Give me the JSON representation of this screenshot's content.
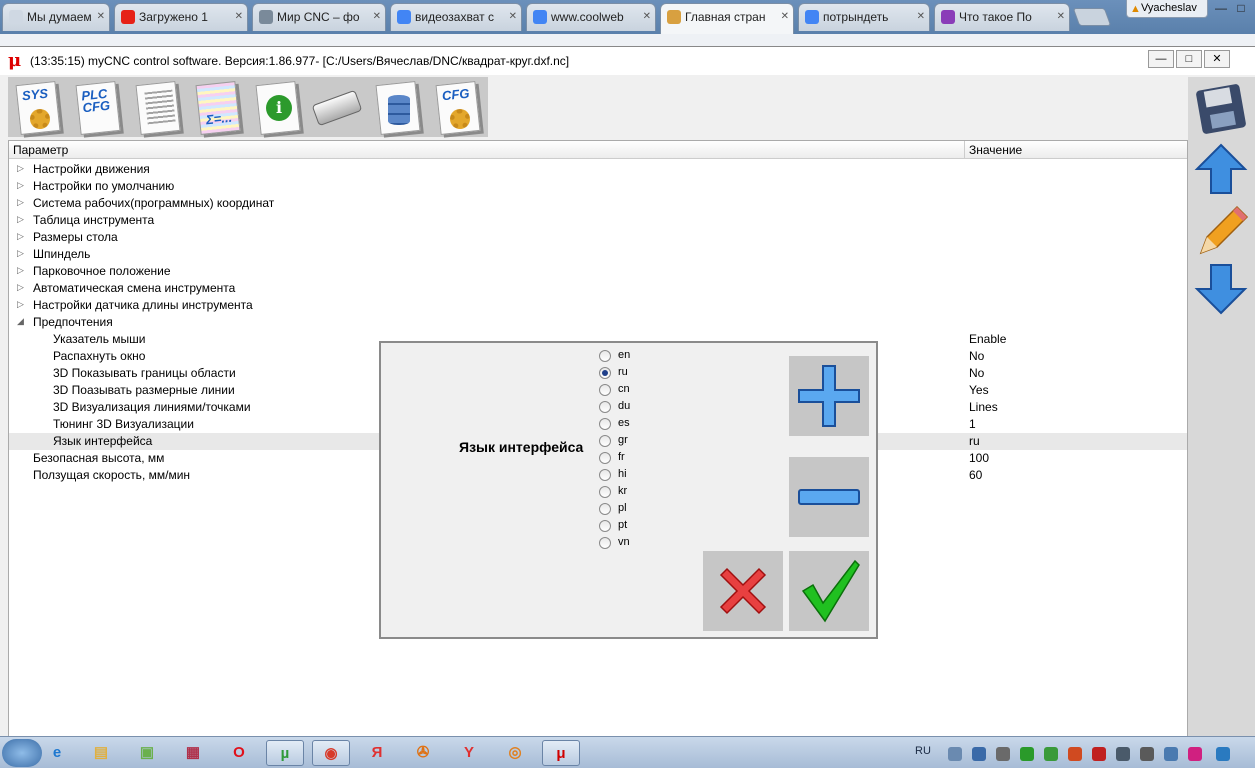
{
  "browser": {
    "tabs": [
      {
        "label": "Мы думаем, ч",
        "icon_color": "#cfd8e3"
      },
      {
        "label": "Загружено 1",
        "icon_color": "#e62117"
      },
      {
        "label": "Мир CNC – фо",
        "icon_color": "#7a8a9a"
      },
      {
        "label": "видеозахват с",
        "icon_color": "#4285f4"
      },
      {
        "label": "www.coolweb",
        "icon_color": "#4285f4"
      },
      {
        "label": "Главная стран",
        "icon_color": "#d8a040"
      },
      {
        "label": "потрындеть",
        "icon_color": "#4285f4"
      },
      {
        "label": "Что такое По",
        "icon_color": "#8a3cb8"
      }
    ],
    "user": "Vyacheslav",
    "minimize": "—",
    "maximize": "□",
    "close": "✕"
  },
  "window": {
    "logo": "μ",
    "title": "(13:35:15)   myCNC control software. Версия:1.86.977-   [C:/Users/Вячеслав/DNC/квадрат-круг.dxf.nc]",
    "minimize": "—",
    "maximize": "□",
    "close": "✕"
  },
  "toolbar": [
    {
      "name": "sys",
      "label": "SYS"
    },
    {
      "name": "plc-cfg",
      "label": "PLC\nCFG"
    },
    {
      "name": "table",
      "label": ""
    },
    {
      "name": "formula",
      "label": "Σ=..."
    },
    {
      "name": "info",
      "label": "i"
    },
    {
      "name": "camera",
      "label": ""
    },
    {
      "name": "database",
      "label": ""
    },
    {
      "name": "cfg",
      "label": "CFG"
    }
  ],
  "tree": {
    "col_param": "Параметр",
    "col_value": "Значение",
    "rows": [
      {
        "name": "Настройки движения",
        "value": "",
        "level": 0,
        "expanded": false
      },
      {
        "name": "Настройки по умолчанию",
        "value": "",
        "level": 0,
        "expanded": false
      },
      {
        "name": "Система рабочих(программных) координат",
        "value": "",
        "level": 0,
        "expanded": false
      },
      {
        "name": "Таблица инструмента",
        "value": "",
        "level": 0,
        "expanded": false
      },
      {
        "name": "Размеры стола",
        "value": "",
        "level": 0,
        "expanded": false
      },
      {
        "name": "Шпиндель",
        "value": "",
        "level": 0,
        "expanded": false
      },
      {
        "name": "Парковочное положение",
        "value": "",
        "level": 0,
        "expanded": false
      },
      {
        "name": "Автоматическая смена инструмента",
        "value": "",
        "level": 0,
        "expanded": false
      },
      {
        "name": "Настройки датчика длины инструмента",
        "value": "",
        "level": 0,
        "expanded": false
      },
      {
        "name": "Предпочтения",
        "value": "",
        "level": 0,
        "expanded": true
      },
      {
        "name": "Указатель мыши",
        "value": "Enable",
        "level": 1
      },
      {
        "name": "Распахнуть окно",
        "value": "No",
        "level": 1
      },
      {
        "name": "3D Показывать границы области",
        "value": "No",
        "level": 1
      },
      {
        "name": "3D Поазывать размерные линии",
        "value": "Yes",
        "level": 1
      },
      {
        "name": "3D Визуализация линиями/точками",
        "value": "Lines",
        "level": 1
      },
      {
        "name": "Тюнинг 3D Визуализации",
        "value": "1",
        "level": 1
      },
      {
        "name": "Язык интерфейса",
        "value": "ru",
        "level": 1,
        "selected": true
      },
      {
        "name": "Безопасная высота, мм",
        "value": "100",
        "level": 0,
        "leaf": true
      },
      {
        "name": "Ползущая скорость, мм/мин",
        "value": "60",
        "level": 0,
        "leaf": true
      }
    ]
  },
  "dialog": {
    "label": "Язык интерфейса",
    "selected": "ru",
    "options": [
      "en",
      "ru",
      "cn",
      "du",
      "es",
      "gr",
      "fr",
      "hi",
      "kr",
      "pl",
      "pt",
      "vn"
    ],
    "buttons": [
      "plus",
      "minus",
      "cancel",
      "ok"
    ]
  },
  "taskbar": {
    "lang": "RU",
    "items": [
      {
        "name": "ie",
        "glyph": "e",
        "color": "#1e78d0",
        "open": false
      },
      {
        "name": "explorer",
        "glyph": "▤",
        "color": "#e0b040",
        "open": false
      },
      {
        "name": "app-green",
        "glyph": "▣",
        "color": "#6ab04c",
        "open": false
      },
      {
        "name": "app-save",
        "glyph": "▦",
        "color": "#b0304a",
        "open": false
      },
      {
        "name": "opera",
        "glyph": "O",
        "color": "#e0101a",
        "open": false
      },
      {
        "name": "utorrent",
        "glyph": "µ",
        "color": "#2f9a3a",
        "open": true
      },
      {
        "name": "chrome",
        "glyph": "◉",
        "color": "#d83a2a",
        "open": true
      },
      {
        "name": "yandex",
        "glyph": "Я",
        "color": "#e03030",
        "open": false
      },
      {
        "name": "media",
        "glyph": "✇",
        "color": "#e07010",
        "open": false
      },
      {
        "name": "yandex-browser",
        "glyph": "Y",
        "color": "#e03030",
        "open": false
      },
      {
        "name": "app-orange",
        "glyph": "◎",
        "color": "#e08020",
        "open": false
      },
      {
        "name": "mycnc",
        "glyph": "μ",
        "color": "#d00000",
        "open": true
      }
    ]
  }
}
